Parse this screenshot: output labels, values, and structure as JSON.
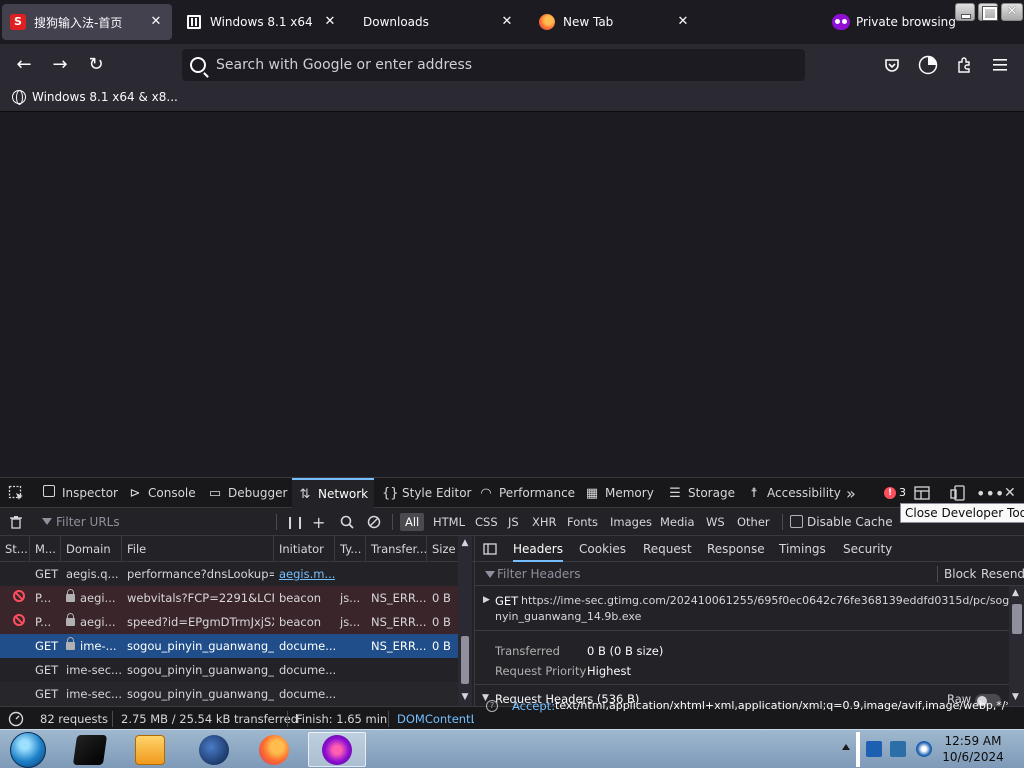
{
  "browser": {
    "tabs": [
      {
        "label": "搜狗输入法-首页",
        "icon": "sogou-icon",
        "active": true
      },
      {
        "label": "Windows 8.1 x64 & x8…",
        "icon": "page-icon",
        "active": false
      },
      {
        "label": "Downloads",
        "icon": "none",
        "active": false
      },
      {
        "label": "New Tab",
        "icon": "firefox-icon",
        "active": false
      }
    ],
    "private_label": "Private browsing",
    "search_placeholder": "Search with Google or enter address",
    "bookmark": "Windows 8.1 x64 & x8..."
  },
  "devtools": {
    "tabs": [
      "Inspector",
      "Console",
      "Debugger",
      "Network",
      "Style Editor",
      "Performance",
      "Memory",
      "Storage",
      "Accessibility"
    ],
    "active_tab": "Network",
    "error_count": "3",
    "error_glyph": "!",
    "tooltip": "Close Developer Tools",
    "filter_placeholder": "Filter URLs",
    "type_filters": [
      "All",
      "HTML",
      "CSS",
      "JS",
      "XHR",
      "Fonts",
      "Images",
      "Media",
      "WS",
      "Other"
    ],
    "disable_cache": "Disable Cache",
    "columns": [
      "St...",
      "M...",
      "Domain",
      "File",
      "Initiator",
      "Ty...",
      "Transfer...",
      "Size"
    ],
    "rows": [
      {
        "status": "",
        "method": "GET",
        "domain": "aegis.q...",
        "file": "performance?dnsLookup=0&",
        "initiator": "aegis.m...",
        "type": "",
        "transferred": "",
        "size": ""
      },
      {
        "status": "blocked",
        "method": "P...",
        "domain": "aegi...",
        "file": "webvitals?FCP=2291&LCP=-1",
        "initiator": "beacon",
        "type": "js...",
        "transferred": "NS_ERR...",
        "size": "0 B"
      },
      {
        "status": "blocked",
        "method": "P...",
        "domain": "aegi...",
        "file": "speed?id=EPgmDTrmJxjSX0vp",
        "initiator": "beacon",
        "type": "js...",
        "transferred": "NS_ERR...",
        "size": "0 B"
      },
      {
        "status": "",
        "method": "GET",
        "domain": "ime-...",
        "file": "sogou_pinyin_guanwang_14",
        "initiator": "docume...",
        "type": "",
        "transferred": "NS_ERR...",
        "size": "0 B"
      },
      {
        "status": "",
        "method": "GET",
        "domain": "ime-sec...",
        "file": "sogou_pinyin_guanwang_14",
        "initiator": "docume...",
        "type": "",
        "transferred": "",
        "size": ""
      },
      {
        "status": "",
        "method": "GET",
        "domain": "ime-sec...",
        "file": "sogou_pinyin_guanwang_14",
        "initiator": "docume...",
        "type": "",
        "transferred": "",
        "size": ""
      }
    ],
    "details": {
      "tabs": [
        "Headers",
        "Cookies",
        "Request",
        "Response",
        "Timings",
        "Security"
      ],
      "active_tab": "Headers",
      "filter_placeholder": "Filter Headers",
      "block_label": "Block",
      "resend_label": "Resend",
      "method": "GET",
      "url_line1": "https://ime-sec.gtimg.com/202410061255/695f0ec0642c76fe368139eddfd0315d/pc/sogou_pi",
      "url_line2": "nyin_guanwang_14.9b.exe",
      "transferred_label": "Transferred",
      "transferred_value": "0 B (0 B size)",
      "priority_label": "Request Priority",
      "priority_value": "Highest",
      "req_headers": "Request Headers (536 B)",
      "raw_label": "Raw",
      "accept_key": "Accept:",
      "accept_value": "text/html,application/xhtml+xml,application/xml;q=0.9,image/avif,image/webp,*/*;q"
    },
    "status": {
      "requests": "82 requests",
      "size": "2.75 MB / 25.54 kB transferred",
      "finish": "Finish: 1.65 min",
      "dom": "DOMContentL"
    }
  },
  "taskbar": {
    "time": "12:59 AM",
    "date": "10/6/2024"
  },
  "colors": {
    "accent": "#75bfff",
    "selected_row": "#204e8a",
    "error": "#ff4f5e",
    "private": "#8f0fd4"
  }
}
